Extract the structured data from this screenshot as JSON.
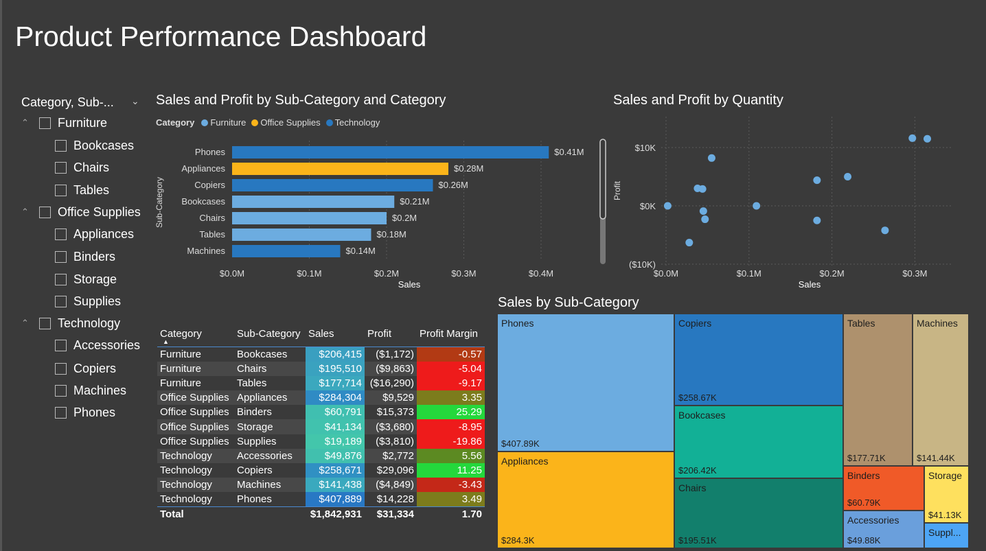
{
  "page": {
    "title": "Product Performance Dashboard"
  },
  "slicer": {
    "header": "Category, Sub-...",
    "groups": [
      {
        "label": "Furniture",
        "items": [
          "Bookcases",
          "Chairs",
          "Tables"
        ]
      },
      {
        "label": "Office Supplies",
        "items": [
          "Appliances",
          "Binders",
          "Storage",
          "Supplies"
        ]
      },
      {
        "label": "Technology",
        "items": [
          "Accessories",
          "Copiers",
          "Machines",
          "Phones"
        ]
      }
    ]
  },
  "bar_chart": {
    "title": "Sales and Profit by Sub-Category and Category",
    "legend_title": "Category",
    "legend": [
      {
        "name": "Furniture",
        "color": "#6cace0"
      },
      {
        "name": "Office Supplies",
        "color": "#fbb41a"
      },
      {
        "name": "Technology",
        "color": "#2878c0"
      }
    ]
  },
  "scatter_chart": {
    "title": "Sales and Profit by Quantity"
  },
  "table": {
    "headers": [
      "Category",
      "Sub-Category",
      "Sales",
      "Profit",
      "Profit Margin"
    ],
    "rows": [
      [
        "Furniture",
        "Bookcases",
        "$206,415",
        "($1,172)",
        "-0.57"
      ],
      [
        "Furniture",
        "Chairs",
        "$195,510",
        "($9,863)",
        "-5.04"
      ],
      [
        "Furniture",
        "Tables",
        "$177,714",
        "($16,290)",
        "-9.17"
      ],
      [
        "Office Supplies",
        "Appliances",
        "$284,304",
        "$9,529",
        "3.35"
      ],
      [
        "Office Supplies",
        "Binders",
        "$60,791",
        "$15,373",
        "25.29"
      ],
      [
        "Office Supplies",
        "Storage",
        "$41,134",
        "($3,680)",
        "-8.95"
      ],
      [
        "Office Supplies",
        "Supplies",
        "$19,189",
        "($3,810)",
        "-19.86"
      ],
      [
        "Technology",
        "Accessories",
        "$49,876",
        "$2,772",
        "5.56"
      ],
      [
        "Technology",
        "Copiers",
        "$258,671",
        "$29,096",
        "11.25"
      ],
      [
        "Technology",
        "Machines",
        "$141,438",
        "($4,849)",
        "-3.43"
      ],
      [
        "Technology",
        "Phones",
        "$407,889",
        "$14,228",
        "3.49"
      ]
    ],
    "sales_colors": [
      "#3a9fc0",
      "#3aa2bf",
      "#3ba8be",
      "#2f8bc4",
      "#40bfb0",
      "#41c2ae",
      "#43c6ab",
      "#41c0ae",
      "#3090c3",
      "#3aa9be",
      "#2878c4"
    ],
    "margin_colors": [
      "#b23a14",
      "#ee1b1b",
      "#ee1b1b",
      "#7c7c1c",
      "#24d83c",
      "#ee1b1b",
      "#ee1b1b",
      "#5c8a22",
      "#24d83c",
      "#c42818",
      "#7c7c1c"
    ],
    "total": [
      "Total",
      "",
      "$1,842,931",
      "$31,334",
      "1.70"
    ]
  },
  "treemap": {
    "title": "Sales by Sub-Category",
    "cells": [
      {
        "label": "Phones",
        "value": "$407.89K",
        "color": "#6cace0"
      },
      {
        "label": "Appliances",
        "value": "$284.3K",
        "color": "#fbb41a"
      },
      {
        "label": "Copiers",
        "value": "$258.67K",
        "color": "#2878c0"
      },
      {
        "label": "Bookcases",
        "value": "$206.42K",
        "color": "#12b096"
      },
      {
        "label": "Chairs",
        "value": "$195.51K",
        "color": "#127f6c"
      },
      {
        "label": "Tables",
        "value": "$177.71K",
        "color": "#ae916d"
      },
      {
        "label": "Machines",
        "value": "$141.44K",
        "color": "#c8b585"
      },
      {
        "label": "Binders",
        "value": "$60.79K",
        "color": "#f05a28"
      },
      {
        "label": "Storage",
        "value": "$41.13K",
        "color": "#fee05e"
      },
      {
        "label": "Accessories",
        "value": "$49.88K",
        "color": "#6a9fdc"
      },
      {
        "label": "Suppl...",
        "value": "",
        "color": "#4da5f5"
      }
    ]
  },
  "chart_data": [
    {
      "type": "bar",
      "orientation": "horizontal",
      "title": "Sales and Profit by Sub-Category and Category",
      "xlabel": "Sales",
      "ylabel": "Sub-Category",
      "categories": [
        "Phones",
        "Appliances",
        "Copiers",
        "Bookcases",
        "Chairs",
        "Tables",
        "Machines"
      ],
      "values": [
        0.41,
        0.28,
        0.26,
        0.21,
        0.2,
        0.18,
        0.14
      ],
      "value_labels": [
        "$0.41M",
        "$0.28M",
        "$0.26M",
        "$0.21M",
        "$0.2M",
        "$0.18M",
        "$0.14M"
      ],
      "category_of": [
        "Technology",
        "Office Supplies",
        "Technology",
        "Furniture",
        "Furniture",
        "Furniture",
        "Technology"
      ],
      "xlim": [
        0,
        0.45
      ],
      "xticks": [
        "$0.0M",
        "$0.1M",
        "$0.2M",
        "$0.3M",
        "$0.4M"
      ],
      "legend": [
        "Furniture",
        "Office Supplies",
        "Technology"
      ],
      "grid": true
    },
    {
      "type": "scatter",
      "title": "Sales and Profit by Quantity",
      "xlabel": "Sales",
      "ylabel": "Profit",
      "xlim": [
        0,
        0.35
      ],
      "ylim": [
        -10000,
        12000
      ],
      "xticks": [
        "$0.0M",
        "$0.1M",
        "$0.2M",
        "$0.3M"
      ],
      "yticks": [
        "$10K",
        "$0K",
        "($10K)"
      ],
      "points": [
        {
          "x": 0.002,
          "y": 0
        },
        {
          "x": 0.028,
          "y": -6300
        },
        {
          "x": 0.038,
          "y": 3000
        },
        {
          "x": 0.044,
          "y": 2900
        },
        {
          "x": 0.045,
          "y": -900
        },
        {
          "x": 0.047,
          "y": -2300
        },
        {
          "x": 0.055,
          "y": 8200
        },
        {
          "x": 0.109,
          "y": 0
        },
        {
          "x": 0.182,
          "y": 4400
        },
        {
          "x": 0.182,
          "y": -2500
        },
        {
          "x": 0.219,
          "y": 5000
        },
        {
          "x": 0.264,
          "y": -4200
        },
        {
          "x": 0.297,
          "y": 11600
        },
        {
          "x": 0.315,
          "y": 11500
        }
      ],
      "color": "#6cace0",
      "grid": true
    }
  ]
}
